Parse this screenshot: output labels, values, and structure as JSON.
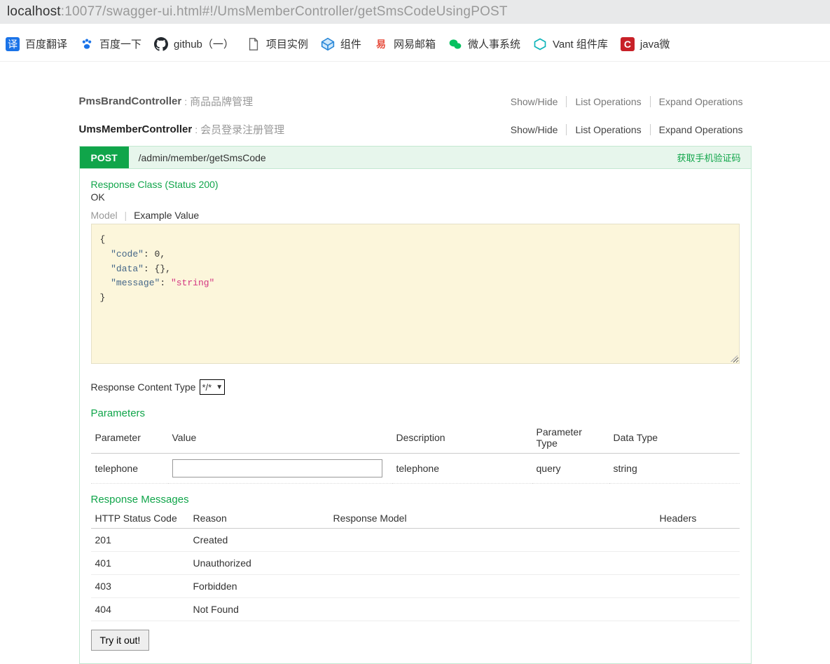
{
  "url": {
    "host": "localhost",
    "path": ":10077/swagger-ui.html#!/UmsMemberController/getSmsCodeUsingPOST"
  },
  "bookmarks": [
    {
      "icon": "译",
      "cls": "bm-blue",
      "label": "百度翻译"
    },
    {
      "icon": "paw",
      "cls": "bm-paw",
      "label": "百度一下"
    },
    {
      "icon": "gh",
      "cls": "",
      "label": "github（一）"
    },
    {
      "icon": "file",
      "cls": "bm-file",
      "label": "项目实例"
    },
    {
      "icon": "hex",
      "cls": "",
      "label": "组件"
    },
    {
      "icon": "易",
      "cls": "",
      "color": "#e74c3c",
      "label": "网易邮箱"
    },
    {
      "icon": "wc",
      "cls": "",
      "color": "#07c160",
      "label": "微人事系统"
    },
    {
      "icon": "vant",
      "cls": "",
      "label": "Vant 组件库"
    },
    {
      "icon": "C",
      "cls": "bm-red",
      "label": "java微"
    }
  ],
  "controllers": [
    {
      "name": "PmsBrandController",
      "desc": "商品品牌管理",
      "active": false
    },
    {
      "name": "UmsMemberController",
      "desc": "会员登录注册管理",
      "active": true
    }
  ],
  "ctrl_ops": [
    "Show/Hide",
    "List Operations",
    "Expand Operations"
  ],
  "operation": {
    "method": "POST",
    "path": "/admin/member/getSmsCode",
    "summary": "获取手机验证码",
    "response_class": "Response Class (Status 200)",
    "response_ok": "OK",
    "model_tab": "Model",
    "example_tab": "Example Value",
    "example_json": "{\n  \"code\": 0,\n  \"data\": {},\n  \"message\": \"string\"\n}",
    "response_content_type_label": "Response Content Type",
    "response_content_type": "*/*"
  },
  "parameters": {
    "title": "Parameters",
    "headers": [
      "Parameter",
      "Value",
      "Description",
      "Parameter Type",
      "Data Type"
    ],
    "rows": [
      {
        "name": "telephone",
        "value": "",
        "description": "telephone",
        "ptype": "query",
        "dtype": "string"
      }
    ]
  },
  "response_messages": {
    "title": "Response Messages",
    "headers": [
      "HTTP Status Code",
      "Reason",
      "Response Model",
      "Headers"
    ],
    "rows": [
      {
        "code": "201",
        "reason": "Created"
      },
      {
        "code": "401",
        "reason": "Unauthorized"
      },
      {
        "code": "403",
        "reason": "Forbidden"
      },
      {
        "code": "404",
        "reason": "Not Found"
      }
    ]
  },
  "try_label": "Try it out!"
}
